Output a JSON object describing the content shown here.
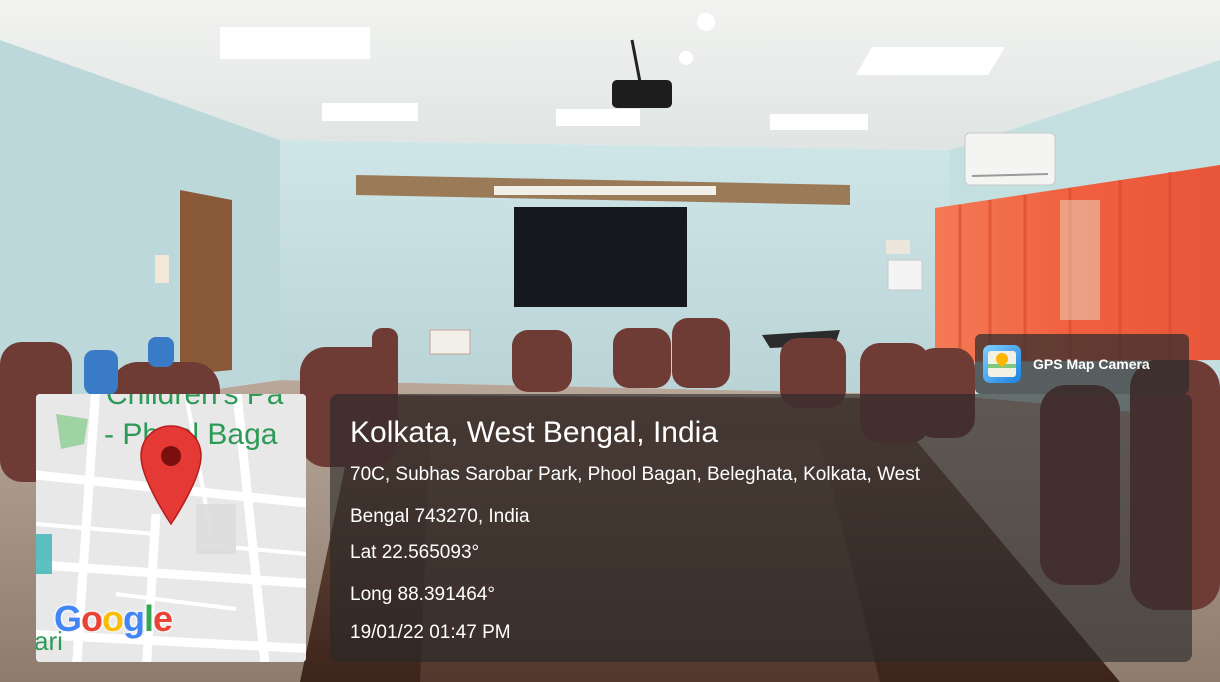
{
  "watermark": {
    "app_label": "GPS Map Camera",
    "icon": "gps-map-camera-app-icon"
  },
  "location": {
    "city_line": "Kolkata, West Bengal, India",
    "address_line_1": "70C, Subhas Sarobar Park, Phool Bagan, Beleghata, Kolkata, West",
    "address_line_2": "Bengal 743270, India",
    "latitude": "Lat 22.565093°",
    "longitude": "Long 88.391464°",
    "datetime": "19/01/22 01:47 PM"
  },
  "map": {
    "place_label_1": "Children's Pa",
    "place_label_2": "- Phool Baga",
    "edge_label": "ari",
    "attribution": "Google",
    "marker_color": "#e53935",
    "label_color": "#2e9a58"
  },
  "colors": {
    "wall": "#cfe6e8",
    "curtain": "#f26a4a",
    "table": "#5a3a2c",
    "chair": "#6e3b35",
    "overlay": "#2d2d2d"
  }
}
